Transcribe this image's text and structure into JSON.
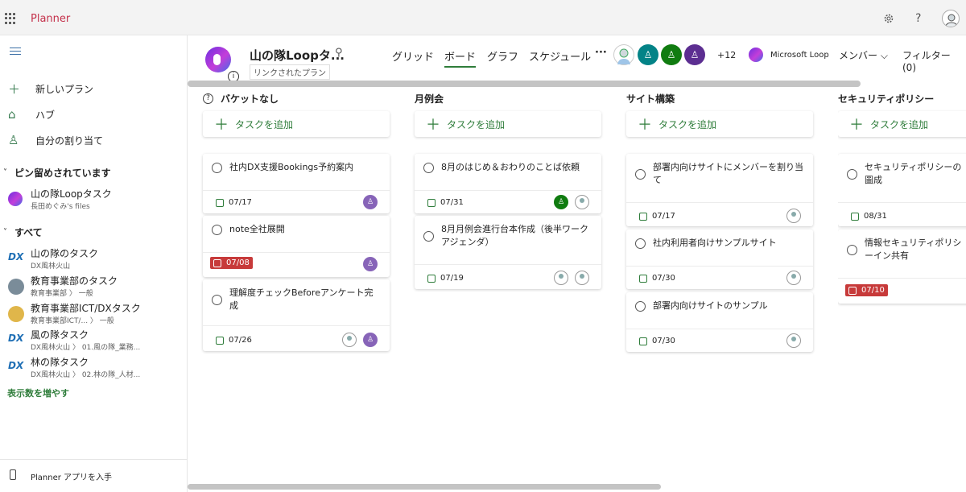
{
  "app": {
    "name": "Planner"
  },
  "topbar": {
    "settings_icon": "gear-icon",
    "help_label": "?"
  },
  "sidebar": {
    "items": [
      {
        "label": "新しいプラン",
        "icon": "plus-icon"
      },
      {
        "label": "ハブ",
        "icon": "home-icon"
      },
      {
        "label": "自分の割り当て",
        "icon": "person-icon"
      }
    ],
    "pinned_header": "ピン留めされています",
    "pinned": [
      {
        "name": "山の隊Loopタスク",
        "sub": "長田めぐみ's files",
        "icon": "loop-icon"
      }
    ],
    "all_header": "すべて",
    "plans": [
      {
        "name": "山の隊のタスク",
        "sub": "DX風林火山",
        "icon": "DX"
      },
      {
        "name": "教育事業部のタスク",
        "sub": "教育事業部 〉 一般",
        "icon": "avatar"
      },
      {
        "name": "教育事業部ICT/DXタスク",
        "sub": "教育事業部ICT/... 〉 一般",
        "icon": "avatar"
      },
      {
        "name": "風の隊タスク",
        "sub": "DX風林火山 〉 01.風の隊_業務...",
        "icon": "DX"
      },
      {
        "name": "林の隊タスク",
        "sub": "DX風林火山 〉 02.林の隊_人材...",
        "icon": "DX"
      }
    ],
    "show_more": "表示数を増やす",
    "get_app": "Planner アプリを入手"
  },
  "header": {
    "title": "山の隊Loopタ...",
    "linked_label": "リンクされたプラン",
    "info_label": "i",
    "tabs": [
      "グリッド",
      "ボード",
      "グラフ",
      "スケジュール"
    ],
    "active_tab": 1,
    "more": "···",
    "member_count": "+12",
    "loop_label": "Microsoft Loop",
    "members_label": "メンバー",
    "filter_label": "フィルター (0)"
  },
  "buckets": [
    {
      "name": "バケットなし",
      "add": "タスクを追加",
      "tasks": [
        {
          "title": "社内DX支援Bookings予約案内",
          "due": "07/17",
          "late": false
        },
        {
          "title": "note全社展開",
          "due": "07/08",
          "late": true
        },
        {
          "title": "理解度チェックBeforeアンケート完成",
          "due": "07/26",
          "late": false
        }
      ]
    },
    {
      "name": "月例会",
      "add": "タスクを追加",
      "tasks": [
        {
          "title": "8月のはじめ＆おわりのことば依頼",
          "due": "07/31",
          "late": false
        },
        {
          "title": "8月月例会進行台本作成（後半ワークアジェンダ）",
          "due": "07/19",
          "late": false
        }
      ]
    },
    {
      "name": "サイト構築",
      "add": "タスクを追加",
      "tasks": [
        {
          "title": "部署内向けサイトにメンバーを割り当て",
          "due": "07/17",
          "late": false
        },
        {
          "title": "社内利用者向けサンプルサイト",
          "due": "07/30",
          "late": false
        },
        {
          "title": "部署内向けサイトのサンプル",
          "due": "07/30",
          "late": false
        }
      ]
    },
    {
      "name": "セキュリティポリシー",
      "add": "タスクを追加",
      "tasks": [
        {
          "title": "セキュリティポリシーの圖成",
          "due": "08/31",
          "late": false
        },
        {
          "title": "情報セキュリティポリシーイン共有",
          "due": "07/10",
          "late": true
        }
      ]
    }
  ],
  "colors": {
    "accent": "#2f7d3b",
    "brand": "#c4314b",
    "late": "#c73a3a",
    "avatar_purple": "#8764b8",
    "avatar_green": "#107c10"
  }
}
